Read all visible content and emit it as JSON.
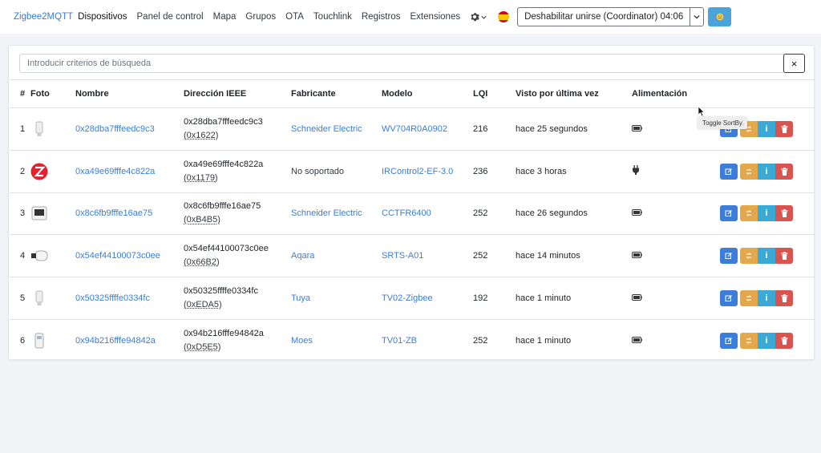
{
  "nav": {
    "brand": "Zigbee2MQTT",
    "links": [
      "Dispositivos",
      "Panel de control",
      "Mapa",
      "Grupos",
      "OTA",
      "Touchlink",
      "Registros",
      "Extensiones"
    ],
    "settings_icon": "gear-icon",
    "language_icon": "spain-flag-icon",
    "permit_join_label": "Deshabilitar unirse (Coordinator) 04:06",
    "permit_dropdown_icon": "chevron-down-icon",
    "extra_button_icon": "smiley-icon"
  },
  "search": {
    "placeholder": "Introducir criterios de búsqueda",
    "value": "",
    "clear_label": "×"
  },
  "table": {
    "headers": [
      "#",
      "Foto",
      "Nombre",
      "Dirección IEEE",
      "Fabricante",
      "Modelo",
      "LQI",
      "Visto por última vez",
      "Alimentación"
    ],
    "rows": [
      {
        "num": "1",
        "name": "0x28dba7fffeedc9c3",
        "ieee": "0x28dba7fffeedc9c3",
        "nwk": "(0x1622)",
        "manufacturer": "Schneider Electric",
        "manufacturer_link": true,
        "model": "WV704R0A0902",
        "lqi": "216",
        "last_seen": "hace 25 segundos",
        "power": "battery-icon",
        "photo": "valve-icon"
      },
      {
        "num": "2",
        "name": "0xa49e69fffe4c822a",
        "ieee": "0xa49e69fffe4c822a",
        "nwk": "(0x1179)",
        "manufacturer": "No soportado",
        "manufacturer_link": false,
        "model": "IRControl2-EF-3.0",
        "lqi": "236",
        "last_seen": "hace 3 horas",
        "power": "plug-icon",
        "photo": "zigbee-logo-icon"
      },
      {
        "num": "3",
        "name": "0x8c6fb9fffe16ae75",
        "ieee": "0x8c6fb9fffe16ae75",
        "nwk": "(0xB4B5)",
        "manufacturer": "Schneider Electric",
        "manufacturer_link": true,
        "model": "CCTFR6400",
        "lqi": "252",
        "last_seen": "hace 26 segundos",
        "power": "battery-icon",
        "photo": "thermostat-icon"
      },
      {
        "num": "4",
        "name": "0x54ef44100073c0ee",
        "ieee": "0x54ef44100073c0ee",
        "nwk": "(0x66B2)",
        "manufacturer": "Aqara",
        "manufacturer_link": true,
        "model": "SRTS-A01",
        "lqi": "252",
        "last_seen": "hace 14 minutos",
        "power": "battery-icon",
        "photo": "radiator-valve-icon"
      },
      {
        "num": "5",
        "name": "0x50325ffffe0334fc",
        "ieee": "0x50325ffffe0334fc",
        "nwk": "(0xEDA5)",
        "manufacturer": "Tuya",
        "manufacturer_link": true,
        "model": "TV02-Zigbee",
        "lqi": "192",
        "last_seen": "hace 1 minuto",
        "power": "battery-icon",
        "photo": "valve-icon"
      },
      {
        "num": "6",
        "name": "0x94b216fffe94842a",
        "ieee": "0x94b216fffe94842a",
        "nwk": "(0xD5E5)",
        "manufacturer": "Moes",
        "manufacturer_link": true,
        "model": "TV01-ZB",
        "lqi": "252",
        "last_seen": "hace 1 minuto",
        "power": "battery-icon",
        "photo": "display-valve-icon"
      }
    ],
    "action_icons": [
      "edit-icon",
      "rename-icon",
      "info-icon",
      "delete-icon"
    ]
  },
  "tooltip": "Toggle SortBy",
  "colors": {
    "link": "#3b7dd8",
    "edit": "#3b7dd8",
    "rename": "#e2a84b",
    "info": "#3ba9d6",
    "delete": "#d9534f",
    "page_bg": "#f3f4f8"
  }
}
